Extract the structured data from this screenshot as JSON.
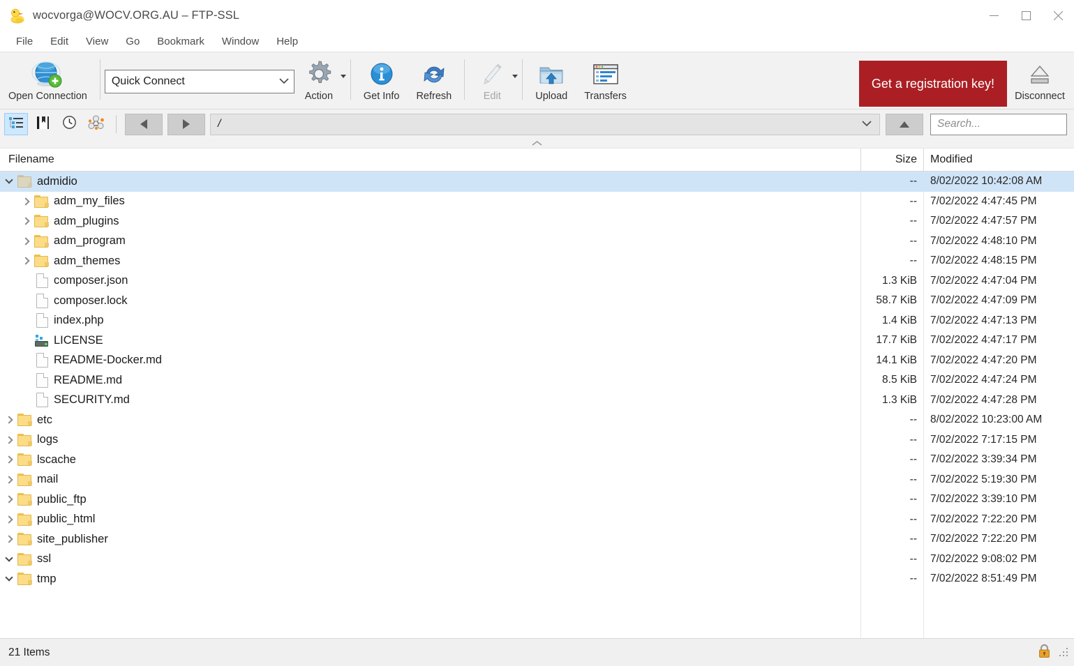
{
  "window": {
    "title": "wocvorga@WOCV.ORG.AU – FTP-SSL",
    "app_icon": "duck-icon",
    "minimize_label": "Minimize",
    "maximize_label": "Maximize",
    "close_label": "Close"
  },
  "menubar": [
    {
      "label": "File"
    },
    {
      "label": "Edit"
    },
    {
      "label": "View"
    },
    {
      "label": "Go"
    },
    {
      "label": "Bookmark"
    },
    {
      "label": "Window"
    },
    {
      "label": "Help"
    }
  ],
  "toolbar": {
    "open_connection": {
      "label": "Open Connection",
      "icon": "globe-plus-icon"
    },
    "quick_connect": {
      "value": "Quick Connect",
      "icon": "chevron-down-icon"
    },
    "action": {
      "label": "Action",
      "icon": "gear-icon"
    },
    "get_info": {
      "label": "Get Info",
      "icon": "info-circle-icon"
    },
    "refresh": {
      "label": "Refresh",
      "icon": "refresh-arrow-icon"
    },
    "edit": {
      "label": "Edit",
      "icon": "pencil-icon",
      "disabled": true
    },
    "upload": {
      "label": "Upload",
      "icon": "folder-upload-icon"
    },
    "transfers": {
      "label": "Transfers",
      "icon": "transfers-window-icon"
    },
    "registration": {
      "label": "Get a registration key!",
      "color": "#ab1f24"
    },
    "disconnect": {
      "label": "Disconnect",
      "icon": "eject-icon"
    }
  },
  "navbar": {
    "view_browser": {
      "icon": "outline-list-icon",
      "active": true
    },
    "view_bookmarks": {
      "icon": "bookmark-book-icon"
    },
    "view_history": {
      "icon": "clock-icon"
    },
    "view_bonjour": {
      "icon": "nodes-graph-icon"
    },
    "back": {
      "icon": "triangle-left-icon"
    },
    "forward": {
      "icon": "triangle-right-icon"
    },
    "path": {
      "value": "/"
    },
    "path_dropdown": {
      "icon": "chevron-down-icon"
    },
    "up": {
      "icon": "triangle-up-icon"
    },
    "search": {
      "placeholder": "Search...",
      "value": "",
      "icon": "search-icon"
    }
  },
  "columns": {
    "filename": "Filename",
    "size": "Size",
    "modified": "Modified"
  },
  "files": [
    {
      "name": "admidio",
      "icon": "folder-icon",
      "twisty": "down",
      "indent": 0,
      "size": "--",
      "modified": "8/02/2022 10:42:08 AM",
      "selected": true
    },
    {
      "name": "adm_my_files",
      "icon": "folder-icon",
      "twisty": "right",
      "indent": 1,
      "size": "--",
      "modified": "7/02/2022 4:47:45 PM",
      "selected": false
    },
    {
      "name": "adm_plugins",
      "icon": "folder-icon",
      "twisty": "right",
      "indent": 1,
      "size": "--",
      "modified": "7/02/2022 4:47:57 PM",
      "selected": false
    },
    {
      "name": "adm_program",
      "icon": "folder-icon",
      "twisty": "right",
      "indent": 1,
      "size": "--",
      "modified": "7/02/2022 4:48:10 PM",
      "selected": false
    },
    {
      "name": "adm_themes",
      "icon": "folder-icon",
      "twisty": "right",
      "indent": 1,
      "size": "--",
      "modified": "7/02/2022 4:48:15 PM",
      "selected": false
    },
    {
      "name": "composer.json",
      "icon": "document-icon",
      "twisty": "none",
      "indent": 1,
      "size": "1.3 KiB",
      "modified": "7/02/2022 4:47:04 PM",
      "selected": false
    },
    {
      "name": "composer.lock",
      "icon": "document-icon",
      "twisty": "none",
      "indent": 1,
      "size": "58.7 KiB",
      "modified": "7/02/2022 4:47:09 PM",
      "selected": false
    },
    {
      "name": "index.php",
      "icon": "document-icon",
      "twisty": "none",
      "indent": 1,
      "size": "1.4 KiB",
      "modified": "7/02/2022 4:47:13 PM",
      "selected": false
    },
    {
      "name": "LICENSE",
      "icon": "binary-icon",
      "twisty": "none",
      "indent": 1,
      "size": "17.7 KiB",
      "modified": "7/02/2022 4:47:17 PM",
      "selected": false
    },
    {
      "name": "README-Docker.md",
      "icon": "document-icon",
      "twisty": "none",
      "indent": 1,
      "size": "14.1 KiB",
      "modified": "7/02/2022 4:47:20 PM",
      "selected": false
    },
    {
      "name": "README.md",
      "icon": "document-icon",
      "twisty": "none",
      "indent": 1,
      "size": "8.5 KiB",
      "modified": "7/02/2022 4:47:24 PM",
      "selected": false
    },
    {
      "name": "SECURITY.md",
      "icon": "document-icon",
      "twisty": "none",
      "indent": 1,
      "size": "1.3 KiB",
      "modified": "7/02/2022 4:47:28 PM",
      "selected": false
    },
    {
      "name": "etc",
      "icon": "folder-icon",
      "twisty": "right",
      "indent": 0,
      "size": "--",
      "modified": "8/02/2022 10:23:00 AM",
      "selected": false
    },
    {
      "name": "logs",
      "icon": "folder-icon",
      "twisty": "right",
      "indent": 0,
      "size": "--",
      "modified": "7/02/2022 7:17:15 PM",
      "selected": false
    },
    {
      "name": "lscache",
      "icon": "folder-icon",
      "twisty": "right",
      "indent": 0,
      "size": "--",
      "modified": "7/02/2022 3:39:34 PM",
      "selected": false
    },
    {
      "name": "mail",
      "icon": "folder-icon",
      "twisty": "right",
      "indent": 0,
      "size": "--",
      "modified": "7/02/2022 5:19:30 PM",
      "selected": false
    },
    {
      "name": "public_ftp",
      "icon": "folder-icon",
      "twisty": "right",
      "indent": 0,
      "size": "--",
      "modified": "7/02/2022 3:39:10 PM",
      "selected": false
    },
    {
      "name": "public_html",
      "icon": "folder-icon",
      "twisty": "right",
      "indent": 0,
      "size": "--",
      "modified": "7/02/2022 7:22:20 PM",
      "selected": false
    },
    {
      "name": "site_publisher",
      "icon": "folder-icon",
      "twisty": "right",
      "indent": 0,
      "size": "--",
      "modified": "7/02/2022 7:22:20 PM",
      "selected": false
    },
    {
      "name": "ssl",
      "icon": "folder-icon",
      "twisty": "down",
      "indent": 0,
      "size": "--",
      "modified": "7/02/2022 9:08:02 PM",
      "selected": false
    },
    {
      "name": "tmp",
      "icon": "folder-icon",
      "twisty": "down",
      "indent": 0,
      "size": "--",
      "modified": "7/02/2022 8:51:49 PM",
      "selected": false
    }
  ],
  "statusbar": {
    "items_text": "21 Items",
    "security_icon": "padlock-icon",
    "resize_grip": "resize-grip-icon"
  }
}
